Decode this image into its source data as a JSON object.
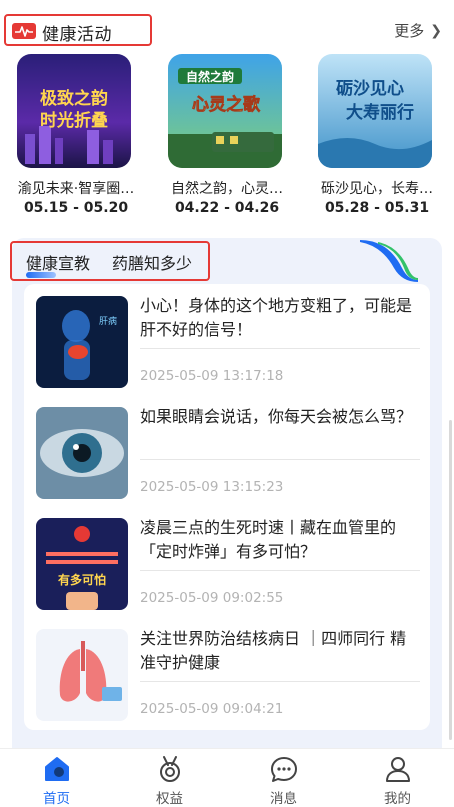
{
  "activity_section": {
    "title": "健康活动",
    "more_label": "更多"
  },
  "activities": [
    {
      "name": "渝见未来·智享圈…",
      "date": "05.15 - 05.20",
      "thumb_text_1": "极致之韵",
      "thumb_text_2": "时光折叠"
    },
    {
      "name": "自然之韵，心灵…",
      "date": "04.22 - 04.26",
      "thumb_text_1": "自然之韵",
      "thumb_text_2": "心灵之歌"
    },
    {
      "name": "砾沙见心，长寿…",
      "date": "05.28 - 05.31",
      "thumb_text_1": "砺沙见心",
      "thumb_text_2": "大寿丽行"
    }
  ],
  "tabs": [
    {
      "label": "健康宣教",
      "active": true
    },
    {
      "label": "药膳知多少",
      "active": false
    }
  ],
  "articles": [
    {
      "title": "小心！身体的这个地方变粗了，可能是肝不好的信号！",
      "time": "2025-05-09 13:17:18"
    },
    {
      "title": "如果眼睛会说话，你每天会被怎么骂？",
      "time": "2025-05-09 13:15:23"
    },
    {
      "title": "凌晨三点的生死时速丨藏在血管里的「定时炸弹」有多可怕？",
      "time": "2025-05-09 09:02:55",
      "thumb_text": "有多可怕"
    },
    {
      "title": "关注世界防治结核病日 ｜四师同行 精准守护健康",
      "time": "2025-05-09 09:04:21"
    }
  ],
  "nav": [
    {
      "label": "首页",
      "icon": "home-icon",
      "active": true
    },
    {
      "label": "权益",
      "icon": "medal-icon",
      "active": false
    },
    {
      "label": "消息",
      "icon": "chat-icon",
      "active": false
    },
    {
      "label": "我的",
      "icon": "user-icon",
      "active": false
    }
  ],
  "colors": {
    "accent": "#1f6cf2",
    "highlight_box": "#e53935",
    "panel_bg": "#eef2fb",
    "timestamp": "#b3b3b3"
  }
}
